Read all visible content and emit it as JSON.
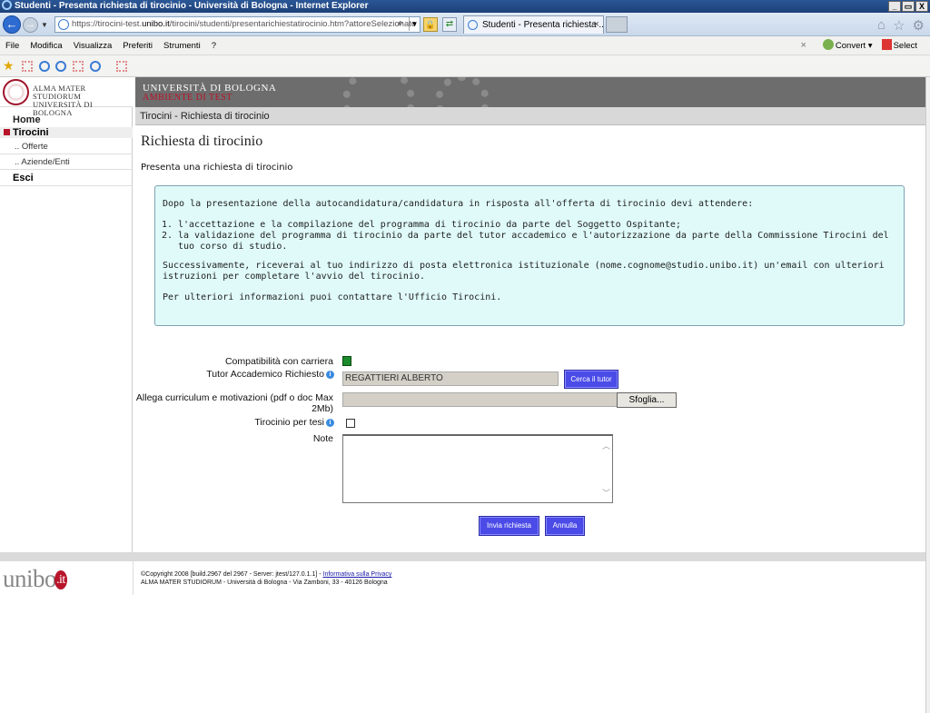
{
  "window": {
    "title": "Studenti - Presenta richiesta di tirocinio - Università di Bologna - Internet Explorer",
    "controls": [
      "_",
      "▭",
      "X"
    ]
  },
  "addressbar": {
    "url_prefix": "https://tirocini-test.",
    "url_host": "unibo.it",
    "url_rest": "/tirocini/studenti/presentarichiestatirocinio.htm?attoreSelezionato",
    "tab_title": "Studenti - Presenta richiesta ..."
  },
  "menubar": {
    "items": [
      "File",
      "Modifica",
      "Visualizza",
      "Preferiti",
      "Strumenti",
      "?"
    ],
    "convert_label": "Convert",
    "select_label": "Select"
  },
  "header": {
    "logo_line1": "ALMA MATER STUDIORUM",
    "logo_line2": "UNIVERSITÀ DI BOLOGNA",
    "banner_title": "UNIVERSITÀ DI BOLOGNA",
    "banner_sub": "AMBIENTE DI TEST"
  },
  "sidebar": {
    "home": "Home",
    "tirocini": "Tirocini",
    "offerte": ".. Offerte",
    "aziende": ".. Aziende/Enti",
    "esci": "Esci"
  },
  "breadcrumb": "Tirocini - Richiesta di tirocinio",
  "page_title": "Richiesta di tirocinio",
  "subtitle": "Presenta una richiesta di tirocinio",
  "info": {
    "intro": "Dopo la presentazione della autocandidatura/candidatura in risposta all'offerta di tirocinio devi attendere:",
    "steps": [
      "l'accettazione e la compilazione del programma di tirocinio da parte del Soggetto Ospitante;",
      "la validazione del programma di tirocinio da parte del tutor accademico e l'autorizzazione da parte della Commissione Tirocini del tuo corso di studio."
    ],
    "next": "Successivamente, riceverai al tuo indirizzo di posta elettronica istituzionale (nome.cognome@studio.unibo.it) un'email con ulteriori istruzioni per completare l'avvio del tirocinio.",
    "contact": "Per ulteriori informazioni puoi contattare l'Ufficio Tirocini."
  },
  "form": {
    "compat_label": "Compatibilità con carriera",
    "tutor_label": "Tutor Accademico Richiesto",
    "tutor_value": "REGATTIERI ALBERTO",
    "tutor_button": "Cerca il tutor",
    "cv_label_line1": "Allega curriculum e motivazioni (pdf o doc Max",
    "cv_label_line2": "2Mb)",
    "browse_button": "Sfoglia...",
    "thesis_label": "Tirocinio per tesi",
    "notes_label": "Note",
    "submit_button": "Invia richiesta",
    "cancel_button": "Annulla"
  },
  "footer": {
    "logo_text": "unibo",
    "logo_it": ".it",
    "copyright": "©Copyright 2008 [build.2967 del 2967 - Server: jtest/127.0.1.1] - ",
    "privacy_link": "Informativa sulla Privacy",
    "address": "ALMA MATER STUDIORUM - Università di Bologna - Via Zamboni, 33 - 40126 Bologna"
  }
}
